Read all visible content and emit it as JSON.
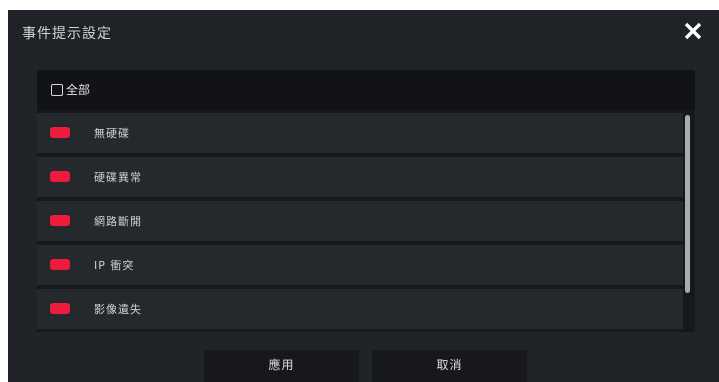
{
  "dialog": {
    "title": "事件提示設定",
    "close_icon": "close-icon"
  },
  "select_all": {
    "label": "全部",
    "checked": false
  },
  "events": [
    {
      "label": "無硬碟",
      "enabled": true
    },
    {
      "label": "硬碟異常",
      "enabled": true
    },
    {
      "label": "網路斷開",
      "enabled": true
    },
    {
      "label": "IP 衝突",
      "enabled": true
    },
    {
      "label": "影像遺失",
      "enabled": true
    }
  ],
  "buttons": {
    "apply": "應用",
    "cancel": "取消"
  },
  "colors": {
    "toggle_on": "#ee1c3c",
    "background": "#202327"
  }
}
